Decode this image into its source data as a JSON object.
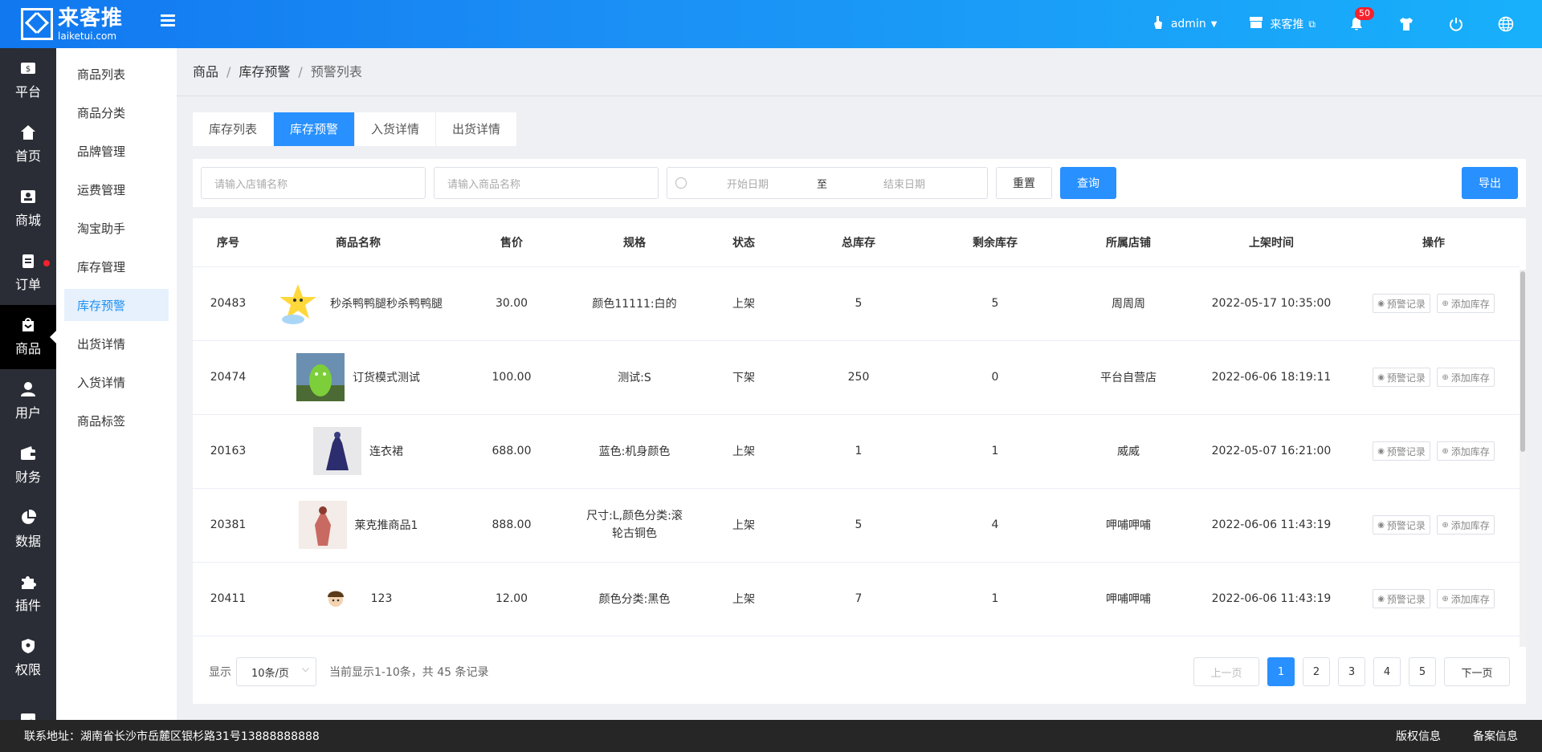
{
  "header": {
    "logo_cn": "来客推",
    "logo_en": "laiketui.com",
    "user": "admin",
    "store_link": "来客推",
    "notification_count": "50"
  },
  "leftnav": [
    {
      "label": "平台",
      "icon": "dollar-icon"
    },
    {
      "label": "首页",
      "icon": "home-icon"
    },
    {
      "label": "商城",
      "icon": "mall-icon"
    },
    {
      "label": "订单",
      "icon": "order-icon"
    },
    {
      "label": "商品",
      "icon": "goods-icon"
    },
    {
      "label": "用户",
      "icon": "user-icon"
    },
    {
      "label": "财务",
      "icon": "wallet-icon"
    },
    {
      "label": "数据",
      "icon": "pie-chart-icon"
    },
    {
      "label": "插件",
      "icon": "puzzle-icon"
    },
    {
      "label": "权限",
      "icon": "shield-icon"
    }
  ],
  "submenu": [
    "商品列表",
    "商品分类",
    "品牌管理",
    "运费管理",
    "淘宝助手",
    "库存管理",
    "库存预警",
    "出货详情",
    "入货详情",
    "商品标签"
  ],
  "breadcrumb": [
    "商品",
    "库存预警",
    "预警列表"
  ],
  "tabs": [
    "库存列表",
    "库存预警",
    "入货详情",
    "出货详情"
  ],
  "filter": {
    "store_placeholder": "请输入店铺名称",
    "goods_placeholder": "请输入商品名称",
    "start_date": "开始日期",
    "to": "至",
    "end_date": "结束日期",
    "reset": "重置",
    "search": "查询",
    "export": "导出"
  },
  "table": {
    "headers": [
      "序号",
      "商品名称",
      "售价",
      "规格",
      "状态",
      "总库存",
      "剩余库存",
      "所属店铺",
      "上架时间",
      "操作"
    ],
    "rows": [
      {
        "id": "20483",
        "name": "秒杀鸭鸭腿秒杀鸭鸭腿",
        "price": "30.00",
        "spec": "颜色11111:白的",
        "status": "上架",
        "total": "5",
        "remain": "5",
        "store": "周周周",
        "time": "2022-05-17 10:35:00"
      },
      {
        "id": "20474",
        "name": "订货模式测试",
        "price": "100.00",
        "spec": "测试:S",
        "status": "下架",
        "total": "250",
        "remain": "0",
        "store": "平台自营店",
        "time": "2022-06-06 18:19:11"
      },
      {
        "id": "20163",
        "name": "连衣裙",
        "price": "688.00",
        "spec": "蓝色:机身颜色",
        "status": "上架",
        "total": "1",
        "remain": "1",
        "store": "威威",
        "time": "2022-05-07 16:21:00"
      },
      {
        "id": "20381",
        "name": "莱克推商品1",
        "price": "888.00",
        "spec": "尺寸:L,颜色分类:滚轮古铜色",
        "status": "上架",
        "total": "5",
        "remain": "4",
        "store": "呷哺呷哺",
        "time": "2022-06-06 11:43:19"
      },
      {
        "id": "20411",
        "name": "123",
        "price": "12.00",
        "spec": "颜色分类:黑色",
        "status": "上架",
        "total": "7",
        "remain": "1",
        "store": "呷哺呷哺",
        "time": "2022-06-06 11:43:19"
      }
    ],
    "op_warning": "预警记录",
    "op_add": "添加库存"
  },
  "pager": {
    "show_label": "显示",
    "page_size": "10条/页",
    "summary": "当前显示1-10条，共 45 条记录",
    "prev": "上一页",
    "next": "下一页",
    "pages": [
      "1",
      "2",
      "3",
      "4",
      "5"
    ]
  },
  "footer": {
    "address": "联系地址：湖南省长沙市岳麓区银杉路31号13888888888",
    "copyright": "版权信息",
    "icp": "备案信息"
  }
}
